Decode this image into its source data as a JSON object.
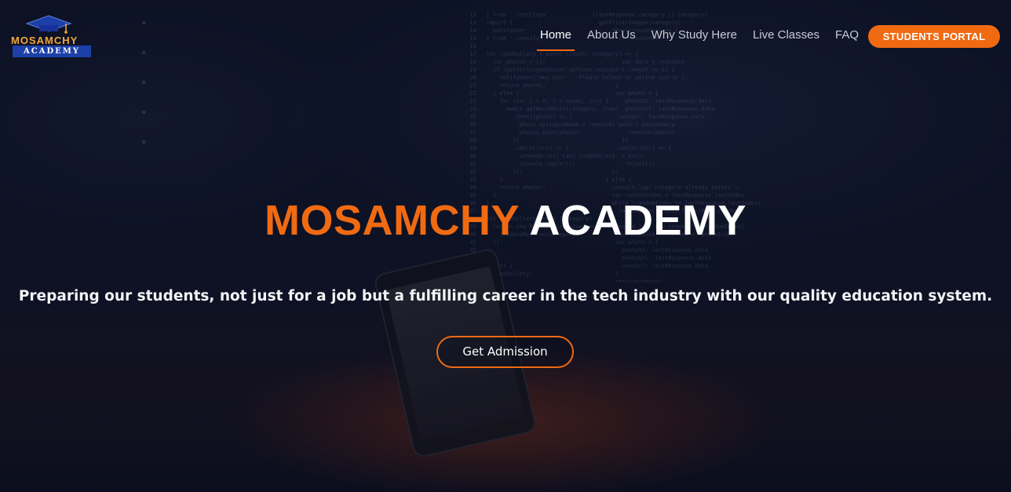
{
  "logo": {
    "top_text": "MOSAMCHY",
    "bottom_text": "ACADEMY",
    "icon": "graduation-cap-icon"
  },
  "nav": {
    "items": [
      {
        "label": "Home",
        "active": true
      },
      {
        "label": "About Us",
        "active": false
      },
      {
        "label": "Why Study Here",
        "active": false
      },
      {
        "label": "Live Classes",
        "active": false
      },
      {
        "label": "FAQ",
        "active": false
      }
    ],
    "portal_button": "STUDENTS PORTAL"
  },
  "hero": {
    "title_part1": "MOSAMCHY",
    "title_part2": "ACADEMY",
    "subtitle": "Preparing our students, not just for a job but a fulfilling career in the tech industry with our quality education system.",
    "cta_label": "Get Admission"
  },
  "colors": {
    "accent": "#f06a12",
    "background": "#0d1226",
    "logo_blue": "#1c3fa8",
    "logo_gold": "#f2a93b"
  }
}
